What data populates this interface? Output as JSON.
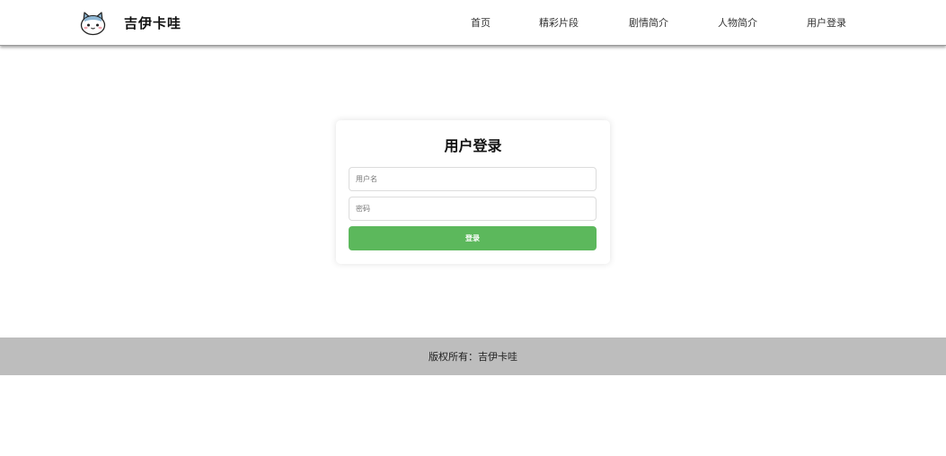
{
  "header": {
    "brand": "吉伊卡哇",
    "logo_icon": "cat-face-icon",
    "nav": [
      {
        "label": "首页"
      },
      {
        "label": "精彩片段"
      },
      {
        "label": "剧情简介"
      },
      {
        "label": "人物简介"
      },
      {
        "label": "用户登录"
      }
    ]
  },
  "login": {
    "title": "用户登录",
    "username_placeholder": "用户名",
    "username_value": "",
    "password_placeholder": "密码",
    "password_value": "",
    "submit_label": "登录"
  },
  "footer": {
    "copyright": "版权所有：吉伊卡哇"
  },
  "colors": {
    "primary_button": "#5cb85c",
    "footer_background": "#bdbdbd",
    "logo_ears": "#8fb8d6"
  }
}
